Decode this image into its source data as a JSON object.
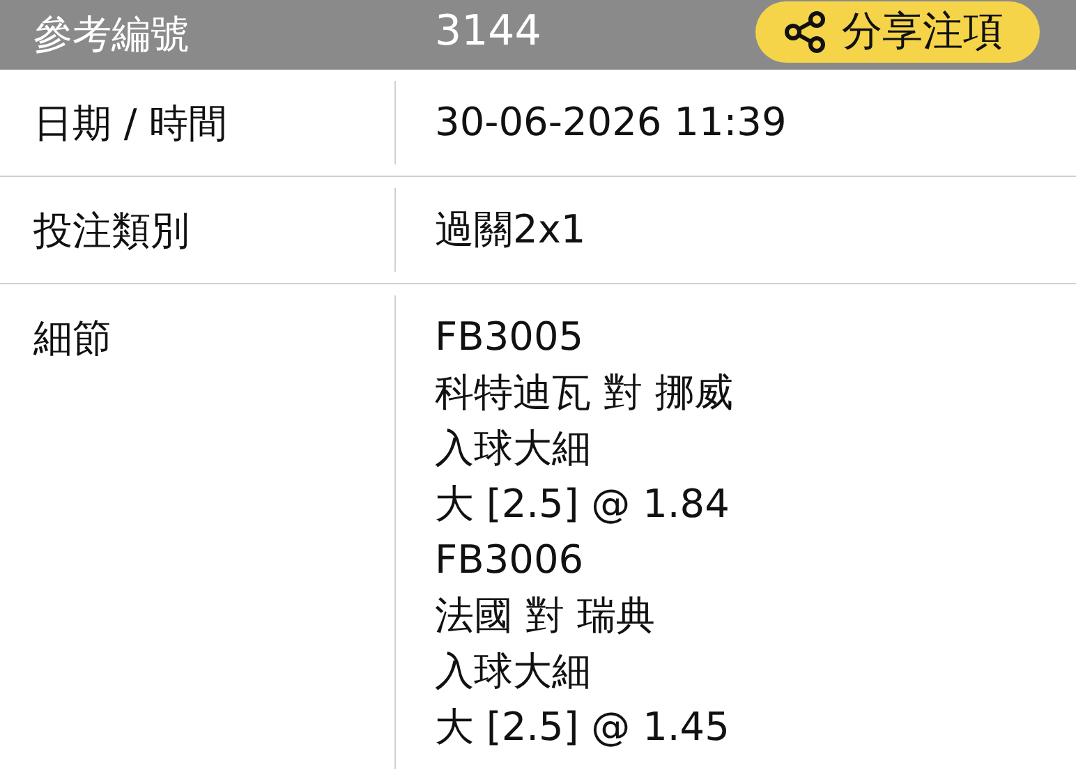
{
  "header": {
    "label": "參考編號",
    "value": "3144",
    "share_button": "分享注項"
  },
  "rows": [
    {
      "label": "日期 / 時間",
      "lines": [
        "30-06-2026 11:39"
      ]
    },
    {
      "label": "投注類別",
      "lines": [
        "過關2x1"
      ]
    },
    {
      "label": "細節",
      "lines": [
        "FB3005",
        "科特迪瓦 對 挪威",
        "入球大細",
        "大 [2.5] @ 1.84",
        "FB3006",
        "法國 對 瑞典",
        "入球大細",
        "大 [2.5] @ 1.45"
      ]
    }
  ]
}
